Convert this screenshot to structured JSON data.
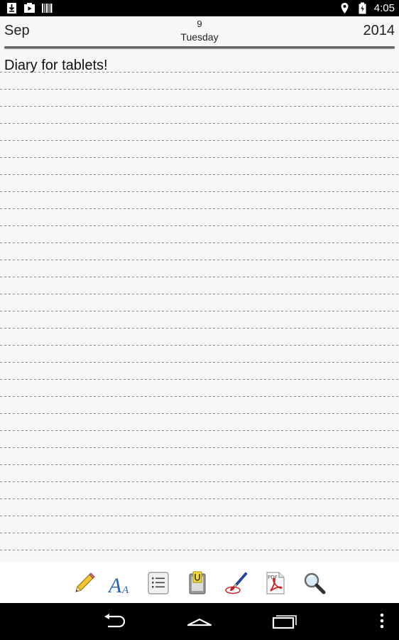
{
  "status_bar": {
    "time": "4:05",
    "left_icons": [
      "download-icon",
      "media-icon",
      "barcode-icon"
    ],
    "right_icons": [
      "location-icon",
      "battery-icon"
    ]
  },
  "date_header": {
    "month": "Sep",
    "day": "9",
    "weekday": "Tuesday",
    "year": "2014"
  },
  "note": {
    "text": "Diary for tablets!"
  },
  "toolbar": {
    "tools": [
      "pencil-icon",
      "font-size-icon",
      "list-icon",
      "clipboard-icon",
      "paintbrush-icon",
      "pdf-icon",
      "magnifier-icon"
    ]
  },
  "nav_bar": {
    "buttons": [
      "back-icon",
      "home-icon",
      "recent-apps-icon",
      "overflow-menu-icon"
    ]
  },
  "colors": {
    "status_bar": "#000000",
    "page_background": "#f7f7f7",
    "rule_line": "#8c8c8c",
    "header_rule": "#666666"
  }
}
